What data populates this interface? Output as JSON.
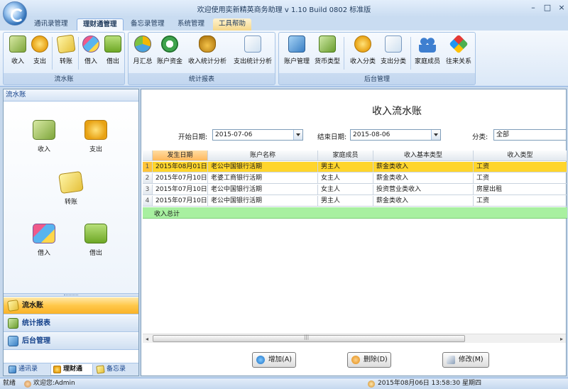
{
  "app": {
    "title": "欢迎使用奕新精英商务助理 v 1.10 Build 0802 标准版",
    "window_controls": {
      "minimize": "–",
      "maximize": "□",
      "close": "×"
    }
  },
  "tabs": [
    {
      "label": "通讯录管理",
      "active": false
    },
    {
      "label": "理财通管理",
      "active": true
    },
    {
      "label": "备忘录管理",
      "active": false
    },
    {
      "label": "系统管理",
      "active": false
    },
    {
      "label": "工具帮助",
      "active": false
    }
  ],
  "ribbon": {
    "groups": [
      {
        "label": "流水账",
        "buttons": [
          {
            "label": "收入",
            "icon": "money-icon"
          },
          {
            "label": "支出",
            "icon": "coins-icon"
          },
          {
            "label": "转账",
            "icon": "card-icon"
          },
          {
            "label": "借入",
            "icon": "colorful-icon"
          },
          {
            "label": "借出",
            "icon": "box-icon"
          }
        ]
      },
      {
        "label": "统计报表",
        "buttons": [
          {
            "label": "月汇总",
            "icon": "pie-icon"
          },
          {
            "label": "账户资金",
            "icon": "cycle-icon"
          },
          {
            "label": "收入统计分析",
            "icon": "moneybag-icon"
          },
          {
            "label": "支出统计分析",
            "icon": "chart-icon"
          }
        ]
      },
      {
        "label": "后台管理",
        "buttons": [
          {
            "label": "账户管理",
            "icon": "notes-icon"
          },
          {
            "label": "货币类型",
            "icon": "bill-icon"
          },
          {
            "label": "收入分类",
            "icon": "coins-icon"
          },
          {
            "label": "支出分类",
            "icon": "chart-icon"
          },
          {
            "label": "家庭成员",
            "icon": "users-icon"
          },
          {
            "label": "往来关系",
            "icon": "diamond-icon"
          }
        ]
      }
    ]
  },
  "left_panel": {
    "header": "流水账",
    "items": [
      {
        "label": "收入",
        "icon": "money-icon"
      },
      {
        "label": "支出",
        "icon": "coins-icon"
      },
      {
        "label": "转账",
        "icon": "card-icon"
      },
      {
        "label": "借入",
        "icon": "colorful-icon"
      },
      {
        "label": "借出",
        "icon": "box-icon"
      }
    ],
    "nav": [
      {
        "label": "流水账",
        "active": true
      },
      {
        "label": "统计报表",
        "active": false
      },
      {
        "label": "后台管理",
        "active": false
      }
    ],
    "bottom_tabs": [
      {
        "label": "通讯录",
        "active": false
      },
      {
        "label": "理财通",
        "active": true
      },
      {
        "label": "备忘录",
        "active": false
      }
    ]
  },
  "main": {
    "title": "收入流水账",
    "filters": {
      "start_label": "开始日期:",
      "start_value": "2015-07-06",
      "end_label": "结束日期:",
      "end_value": "2015-08-06",
      "category_label": "分类:",
      "category_value": "全部"
    },
    "table": {
      "columns": [
        "发生日期",
        "账户名称",
        "家庭成员",
        "收入基本类型",
        "收入类型"
      ],
      "sorted_column": 0,
      "rows": [
        {
          "num": "1",
          "date": "2015年08月01日",
          "account": "老公中国银行活期",
          "member": "男主人",
          "base_type": "薪金类收入",
          "type": "工资",
          "selected": true
        },
        {
          "num": "2",
          "date": "2015年07月10日",
          "account": "老婆工商银行活期",
          "member": "女主人",
          "base_type": "薪金类收入",
          "type": "工资",
          "selected": false
        },
        {
          "num": "3",
          "date": "2015年07月10日",
          "account": "老公中国银行活期",
          "member": "女主人",
          "base_type": "投资营业类收入",
          "type": "房屋出租",
          "selected": false
        },
        {
          "num": "4",
          "date": "2015年07月10日",
          "account": "老公中国银行活期",
          "member": "男主人",
          "base_type": "薪金类收入",
          "type": "工资",
          "selected": false
        }
      ],
      "total_label": "收入总计"
    },
    "buttons": {
      "add": "增加(A)",
      "delete": "删除(D)",
      "edit": "修改(M)"
    }
  },
  "statusbar": {
    "ready": "就绪",
    "welcome": "欢迎您:Admin",
    "datetime": "2015年08月06日  13:58:30  星期四"
  },
  "colors": {
    "selected_row": "#ffd52c",
    "total_row": "#a8f0a0",
    "active_nav": "#ffc84a",
    "ribbon_border": "#a8c4e6"
  }
}
